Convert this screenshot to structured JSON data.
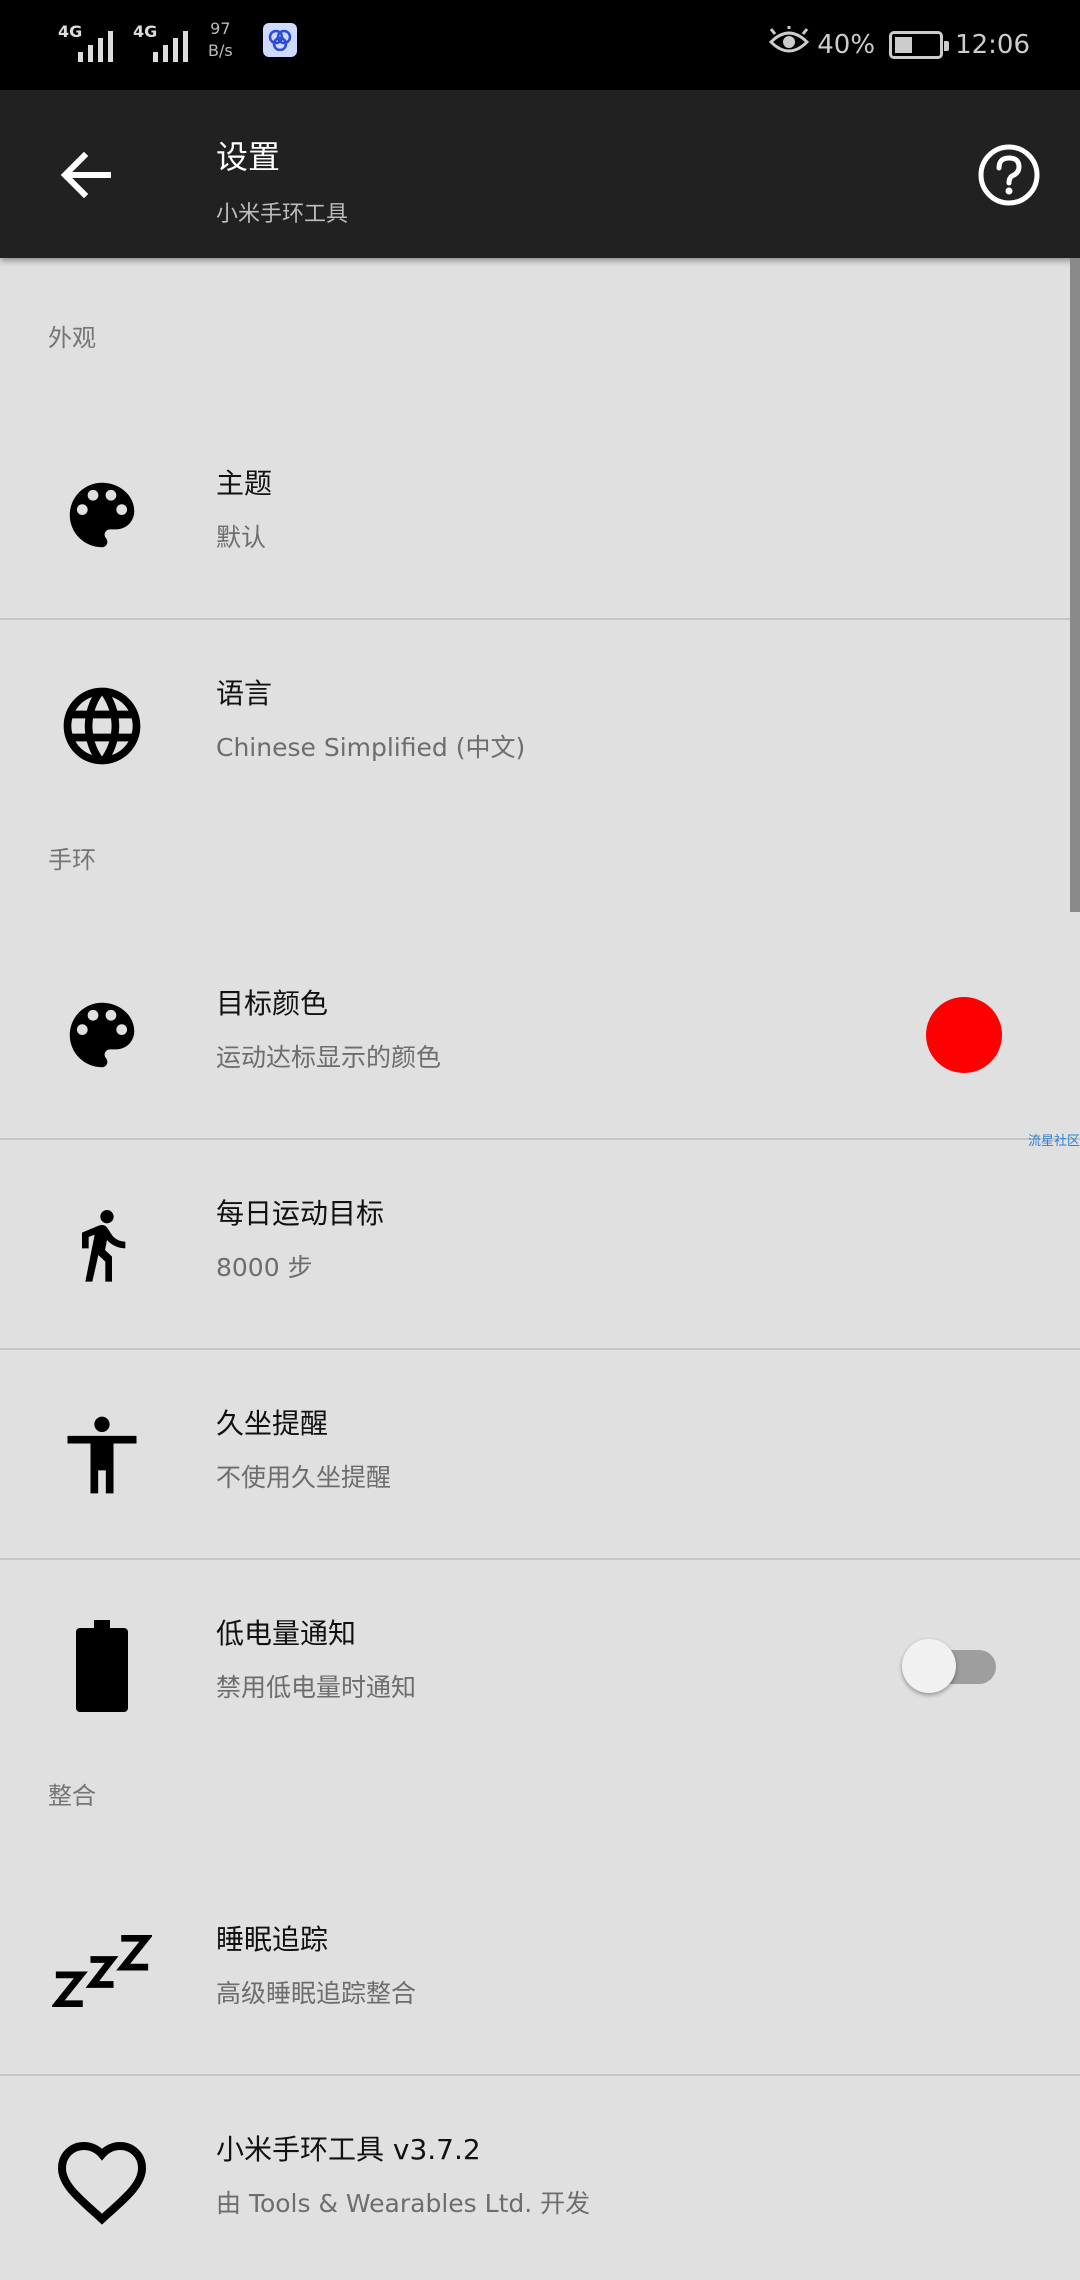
{
  "status_bar": {
    "net1": "4G",
    "net2": "4G",
    "speed_value": "97",
    "speed_unit": "B/s",
    "battery_percent": "40%",
    "battery_level": 0.4,
    "time": "12:06"
  },
  "app_bar": {
    "title": "设置",
    "subtitle": "小米手环工具"
  },
  "sections": {
    "appearance": "外观",
    "band": "手环",
    "integration": "整合"
  },
  "prefs": {
    "theme": {
      "title": "主题",
      "summary": "默认"
    },
    "language": {
      "title": "语言",
      "summary": "Chinese Simplified (中文)"
    },
    "goal_color": {
      "title": "目标颜色",
      "summary": "运动达标显示的颜色",
      "color": "#ff0000"
    },
    "daily_goal": {
      "title": "每日运动目标",
      "summary": "8000 步"
    },
    "idle_alert": {
      "title": "久坐提醒",
      "summary": "不使用久坐提醒"
    },
    "low_battery": {
      "title": "低电量通知",
      "summary": "禁用低电量时通知",
      "enabled": false
    },
    "sleep": {
      "title": "睡眠追踪",
      "summary": "高级睡眠追踪整合"
    },
    "about": {
      "title": "小米手环工具 v3.7.2",
      "summary": "由 Tools & Wearables Ltd. 开发"
    }
  },
  "watermark": "流星社区",
  "icons": [
    "arrow-back-icon",
    "help-icon",
    "palette-icon",
    "globe-icon",
    "walk-icon",
    "person-icon",
    "battery-icon",
    "sleep-zzz-icon",
    "heart-icon",
    "eye-icon"
  ]
}
